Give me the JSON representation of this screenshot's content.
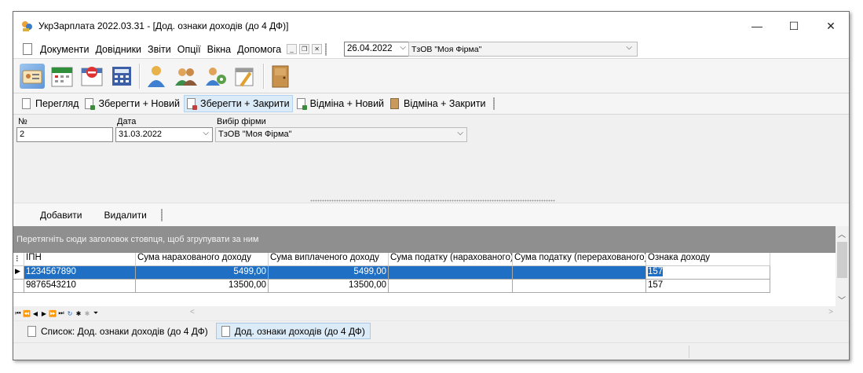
{
  "window": {
    "title": "УкрЗарплата 2022.03.31 - [Дод. ознаки доходів (до 4 ДФ)]"
  },
  "menu": {
    "items": [
      "Документи",
      "Довідники",
      "Звіти",
      "Опції",
      "Вікна",
      "Допомога"
    ]
  },
  "toolbar": {
    "date": "26.04.2022",
    "firm": "ТзОВ \"Моя Фірма\""
  },
  "actions": {
    "view": "Перегляд",
    "save_new": "Зберегти + Новий",
    "save_close": "Зберегти + Закрити",
    "cancel_new": "Відміна + Новий",
    "cancel_close": "Відміна + Закрити"
  },
  "form": {
    "number_label": "№",
    "number_value": "2",
    "date_label": "Дата",
    "date_value": "31.03.2022",
    "firm_label": "Вибір фірми",
    "firm_value": "ТзОВ \"Моя Фірма\""
  },
  "grid_actions": {
    "add": "Добавити",
    "delete": "Видалити"
  },
  "grid": {
    "group_hint": "Перетягніть сюди заголовок стовпця, щоб згрупувати за ним",
    "columns": [
      "ІПН",
      "Сума нарахованого доходу",
      "Сума виплаченого доходу",
      "Сума податку (нарахованого)",
      "Сума податку (перерахованого)",
      "Ознака доходу"
    ],
    "rows": [
      {
        "ipn": "1234567890",
        "accrued": "5499,00",
        "paid": "5499,00",
        "tax_accrued": "",
        "tax_transferred": "",
        "sign": "157"
      },
      {
        "ipn": "9876543210",
        "accrued": "13500,00",
        "paid": "13500,00",
        "tax_accrued": "",
        "tax_transferred": "",
        "sign": "157"
      }
    ]
  },
  "tabs": [
    "Список: Дод. ознаки доходів (до 4 ДФ)",
    "Дод. ознаки доходів (до 4 ДФ)"
  ],
  "colors": {
    "selection": "#1f6fc5",
    "group_panel": "#8f8f8f",
    "active_tab": "#dcebf8"
  }
}
